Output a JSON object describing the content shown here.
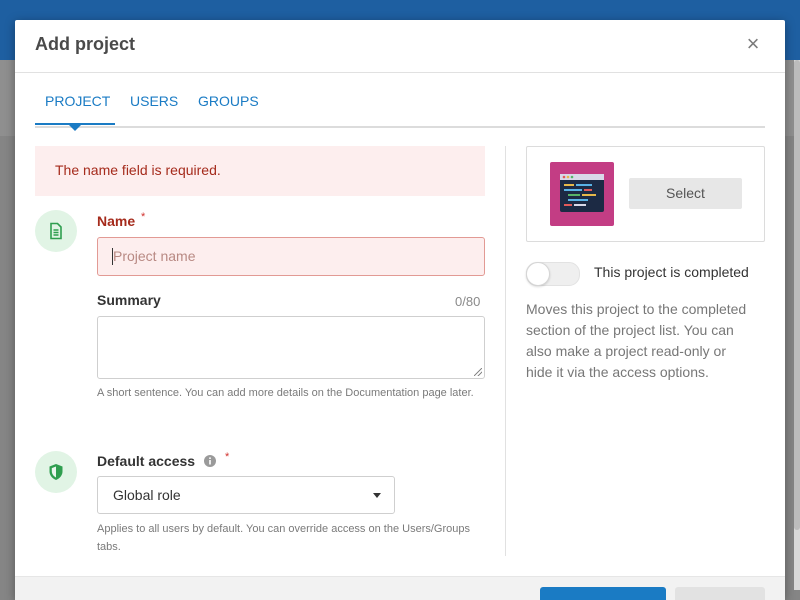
{
  "modal": {
    "title": "Add project",
    "close_label": "×"
  },
  "tabs": [
    {
      "label": "PROJECT",
      "active": true
    },
    {
      "label": "USERS",
      "active": false
    },
    {
      "label": "GROUPS",
      "active": false
    }
  ],
  "error": {
    "message": "The name field is required."
  },
  "name_field": {
    "label": "Name",
    "required_mark": "*",
    "value": "",
    "placeholder": "Project name"
  },
  "summary_field": {
    "label": "Summary",
    "counter": "0/80",
    "value": "",
    "help": "A short sentence. You can add more details on the Documentation page later."
  },
  "access_field": {
    "label": "Default access",
    "required_mark": "*",
    "selected": "Global role",
    "help": "Applies to all users by default. You can override access on the Users/Groups tabs."
  },
  "image_card": {
    "select_label": "Select"
  },
  "completed_toggle": {
    "label": "This project is completed",
    "state": "off",
    "description": "Moves this project to the completed section of the project list. You can also make a project read-only or hide it via the access options."
  },
  "colors": {
    "accent": "#1a7bc4",
    "error_text": "#a52b1c",
    "error_bg": "#fdeeee",
    "icon_bg": "#e1f4e5",
    "icon_fg": "#2f9e4f",
    "project_image_bg": "#c33d84"
  },
  "icons": {
    "name_section": "document-icon",
    "access_section": "shield-icon",
    "access_info": "info-icon",
    "close": "close-icon"
  }
}
